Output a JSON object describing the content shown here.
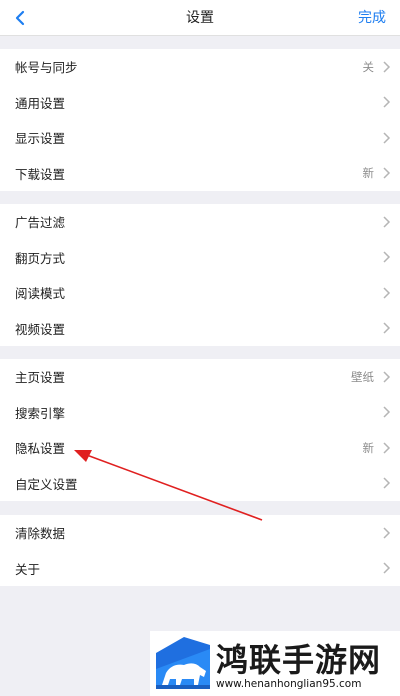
{
  "nav": {
    "title": "设置",
    "done_label": "完成"
  },
  "groups": [
    {
      "items": [
        {
          "label": "帐号与同步",
          "value": "关"
        },
        {
          "label": "通用设置",
          "value": ""
        },
        {
          "label": "显示设置",
          "value": ""
        },
        {
          "label": "下载设置",
          "value": "新"
        }
      ]
    },
    {
      "items": [
        {
          "label": "广告过滤",
          "value": ""
        },
        {
          "label": "翻页方式",
          "value": ""
        },
        {
          "label": "阅读模式",
          "value": ""
        },
        {
          "label": "视频设置",
          "value": ""
        }
      ]
    },
    {
      "items": [
        {
          "label": "主页设置",
          "value": "壁纸"
        },
        {
          "label": "搜索引擎",
          "value": ""
        },
        {
          "label": "隐私设置",
          "value": "新"
        },
        {
          "label": "自定义设置",
          "value": ""
        }
      ]
    },
    {
      "items": [
        {
          "label": "清除数据",
          "value": ""
        },
        {
          "label": "关于",
          "value": ""
        }
      ]
    }
  ],
  "watermark": {
    "brand": "鸿联手游网",
    "url": "www.henanhonglian95.com"
  },
  "colors": {
    "accent": "#1e7ef0",
    "annotation_arrow": "#e02020",
    "background": "#efeff4"
  }
}
